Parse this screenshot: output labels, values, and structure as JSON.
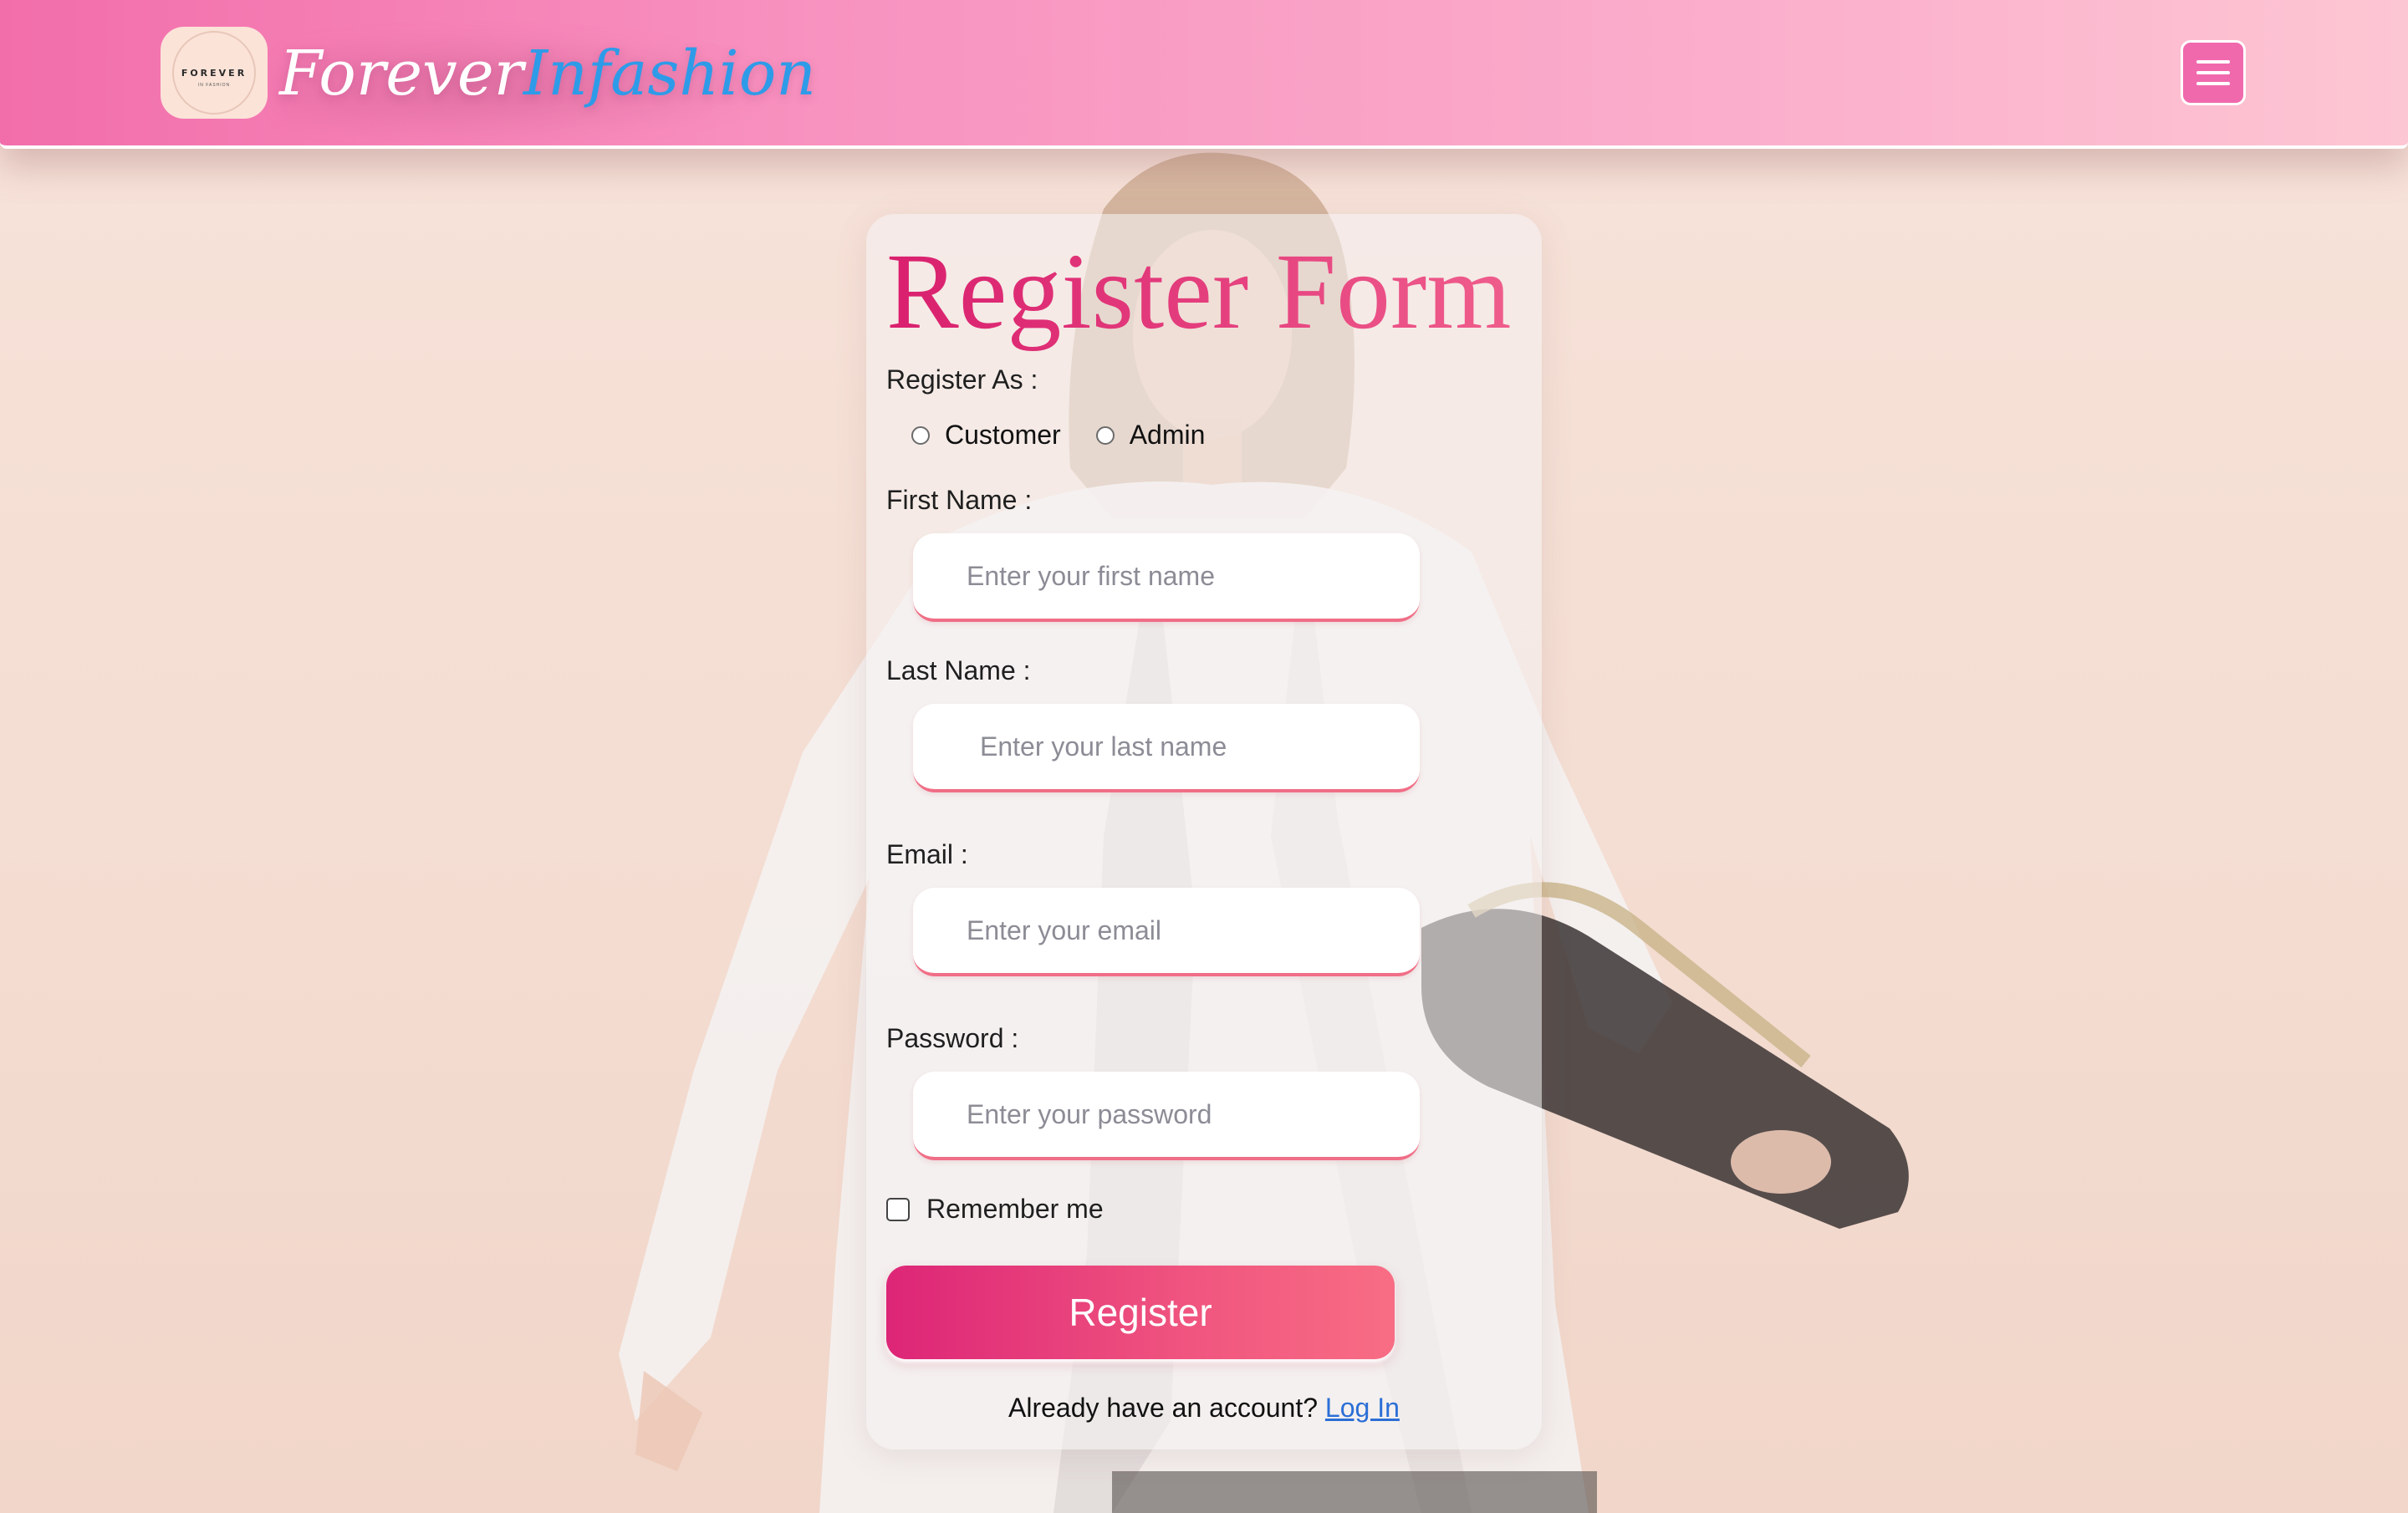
{
  "header": {
    "brand_part_1": "Forever",
    "brand_part_2": "Infashion",
    "logo_text": "FOREVER",
    "logo_subtext": "IN FASHION",
    "menu_icon": "hamburger-menu-icon"
  },
  "form": {
    "title": "Register Form",
    "register_as_label": "Register As :",
    "role_options": [
      "Customer",
      "Admin"
    ],
    "fields": [
      {
        "label": "First Name :",
        "placeholder": "Enter your first name",
        "value": ""
      },
      {
        "label": "Last Name :",
        "placeholder": "Enter your last name",
        "value": ""
      },
      {
        "label": "Email :",
        "placeholder": "Enter your email",
        "value": ""
      },
      {
        "label": "Password :",
        "placeholder": "Enter your password",
        "value": ""
      }
    ],
    "remember_label": "Remember me",
    "submit_label": "Register",
    "footer_text": "Already have an account?",
    "footer_link": "Log In"
  },
  "colors": {
    "header_gradient_start": "#f26eab",
    "header_gradient_end": "#fdc6d3",
    "brand_accent": "#2e9be8",
    "title_gradient_start": "#d91f6e",
    "title_gradient_end": "#ef5d8c",
    "button_gradient_start": "#dd2577",
    "button_gradient_end": "#f86d84",
    "link": "#2b6fd6"
  }
}
